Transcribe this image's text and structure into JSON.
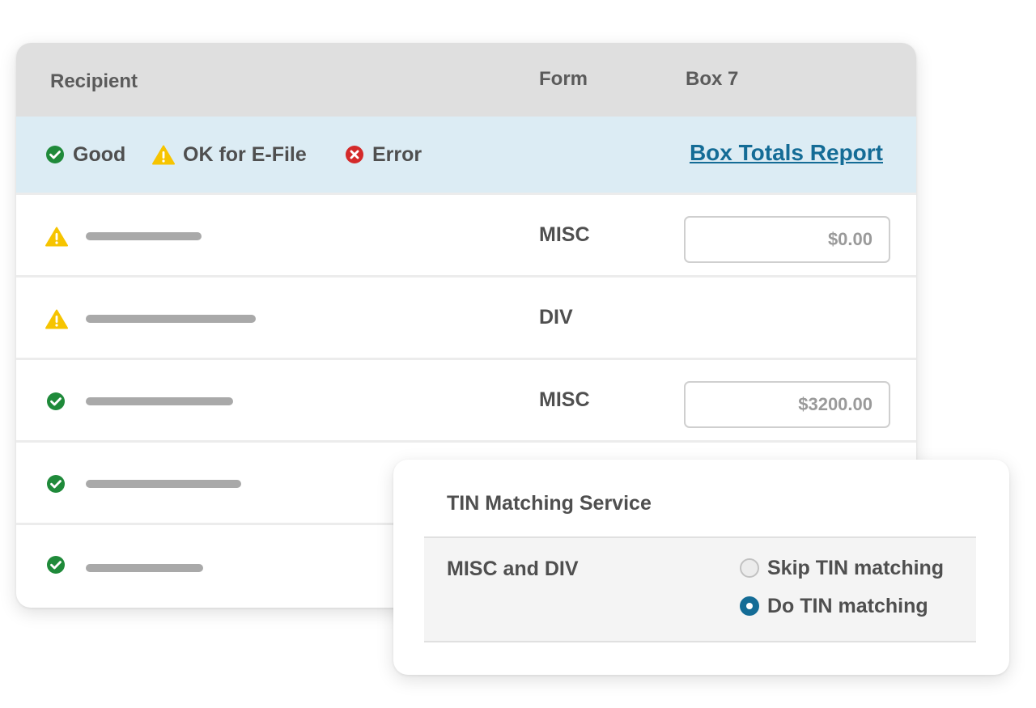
{
  "table": {
    "headers": {
      "recipient": "Recipient",
      "form": "Form",
      "box7": "Box 7"
    },
    "legend": {
      "good": "Good",
      "ok_efile": "OK for E-File",
      "error": "Error",
      "report_link": "Box Totals Report"
    },
    "rows": [
      {
        "status": "warning",
        "form": "MISC",
        "box7": "$0.00"
      },
      {
        "status": "warning",
        "form": "DIV",
        "box7": ""
      },
      {
        "status": "good",
        "form": "MISC",
        "box7": "$3200.00"
      },
      {
        "status": "good",
        "form": "",
        "box7": ""
      },
      {
        "status": "good",
        "form": "",
        "box7": ""
      }
    ]
  },
  "tin_panel": {
    "title": "TIN Matching Service",
    "forms_label": "MISC and DIV",
    "options": [
      {
        "label": "Skip TIN matching",
        "selected": false
      },
      {
        "label": "Do TIN matching",
        "selected": true
      }
    ]
  },
  "colors": {
    "good": "#1f8a3a",
    "warning": "#f6c400",
    "error": "#d42a2a",
    "link": "#146c96",
    "legend_bg": "#dcecf4",
    "header_bg": "#dfdfdf"
  }
}
